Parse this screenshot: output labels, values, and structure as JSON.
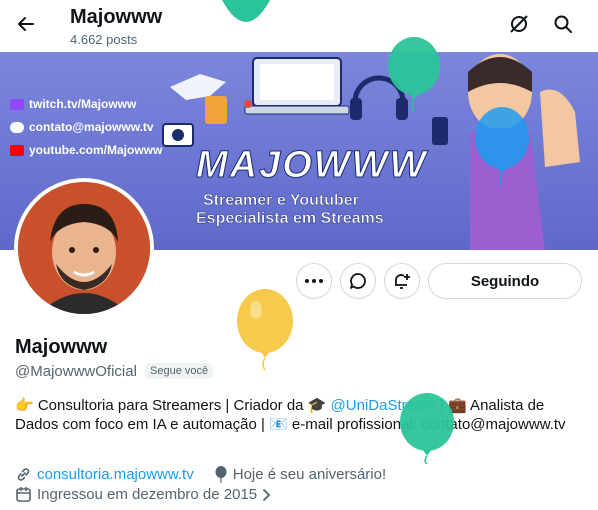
{
  "header": {
    "title": "Majowww",
    "post_count": "4.662 posts"
  },
  "banner": {
    "links": [
      "twitch.tv/Majowww",
      "contato@majowww.tv",
      "youtube.com/Majowww"
    ],
    "title": "MAJOWWW",
    "line1": "Streamer e Youtuber",
    "line2": "Especialista em Streams"
  },
  "actions": {
    "follow_label": "Seguindo"
  },
  "profile": {
    "name": "Majowww",
    "handle": "@MajowwwOficial",
    "follows_you": "Segue você",
    "bio_part1": "👉 Consultoria para Streamers | Criador da 🎓 ",
    "bio_mention": "@UniDaStream",
    "bio_part2": " | 💼 Analista de Dados com foco em IA e automação | 📧 e-mail profissional: contato@majowww.tv",
    "website": "consultoria.majowww.tv",
    "birthday": "Hoje é seu aniversário!",
    "joined": "Ingressou em dezembro de 2015"
  },
  "colors": {
    "accent": "#1d9bf0",
    "banner": "#6c77d3",
    "balloon_green": "#2bc49a",
    "balloon_blue": "#1d9bf0",
    "balloon_yellow": "#f5c842"
  },
  "icons": [
    "back-arrow-icon",
    "hide-icon",
    "search-icon",
    "more-icon",
    "message-icon",
    "notify-icon",
    "link-icon",
    "balloon-icon",
    "calendar-icon",
    "chevron-right-icon"
  ]
}
